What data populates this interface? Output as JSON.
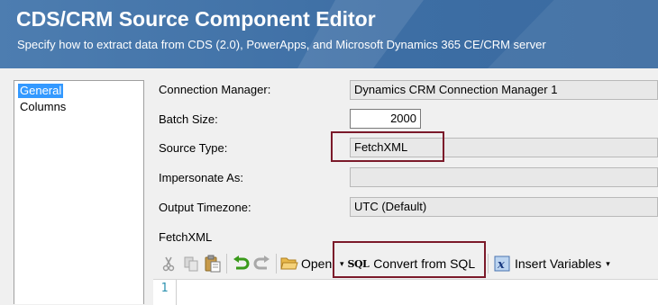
{
  "header": {
    "title": "CDS/CRM Source Component Editor",
    "subtitle": "Specify how to extract data from CDS (2.0), PowerApps, and Microsoft Dynamics 365 CE/CRM server"
  },
  "nav": {
    "items": [
      {
        "label": "General",
        "selected": true
      },
      {
        "label": "Columns",
        "selected": false
      }
    ]
  },
  "form": {
    "connection_manager": {
      "label": "Connection Manager:",
      "value": "Dynamics CRM Connection Manager 1"
    },
    "batch_size": {
      "label": "Batch Size:",
      "value": "2000"
    },
    "source_type": {
      "label": "Source Type:",
      "value": "FetchXML"
    },
    "impersonate_as": {
      "label": "Impersonate As:",
      "value": ""
    },
    "output_timezone": {
      "label": "Output Timezone:",
      "value": "UTC (Default)"
    },
    "fetchxml_label": "FetchXML"
  },
  "toolbar": {
    "open_label": "Open",
    "sql_badge": "SQL",
    "convert_label": "Convert from SQL",
    "insert_label": "Insert Variables",
    "dropdown_glyph": "▾"
  },
  "editor": {
    "line_numbers": [
      "1"
    ]
  },
  "colors": {
    "header_bg": "#3d6ea4",
    "highlight": "#7b1a2a",
    "selection": "#3399ff"
  }
}
